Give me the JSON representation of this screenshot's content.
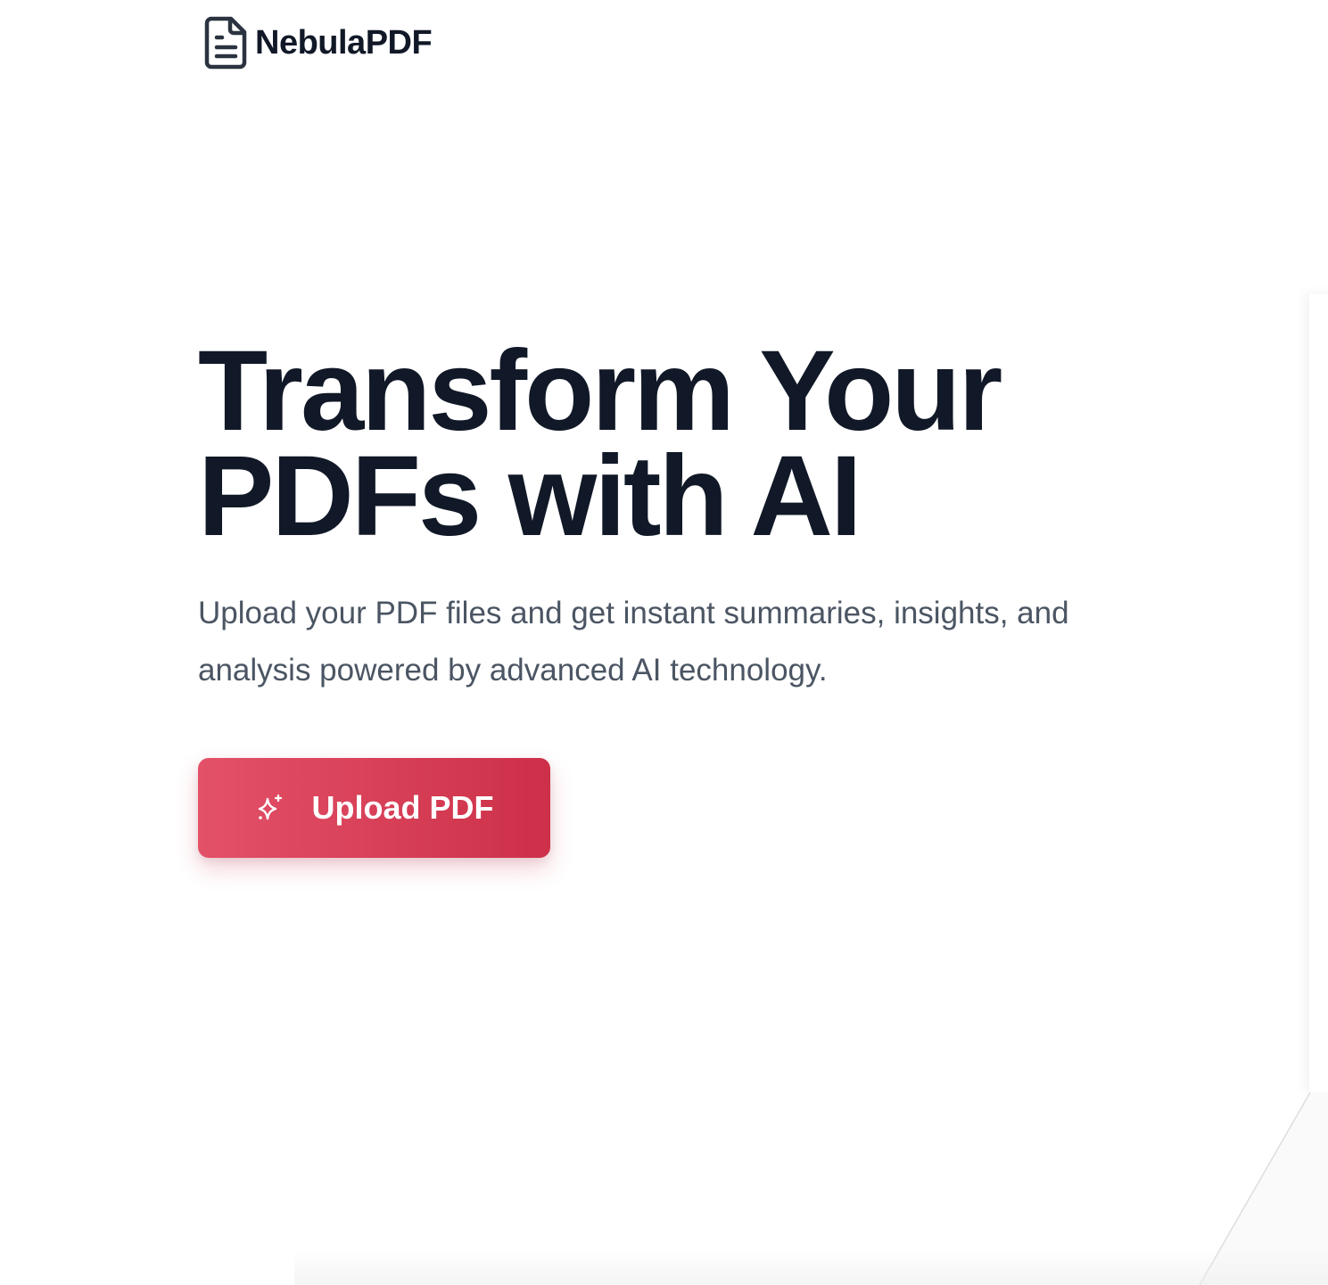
{
  "header": {
    "logo_icon": "document-icon",
    "brand": "NebulaPDF"
  },
  "hero": {
    "title_line1": "Transform Your",
    "title_line2": "PDFs with AI",
    "subtitle": "Upload your PDF files and get instant summaries, insights, and analysis powered by advanced AI technology.",
    "cta": {
      "icon": "sparkle-icon",
      "label": "Upload PDF"
    }
  },
  "colors": {
    "text_primary": "#111827",
    "text_secondary": "#4b5563",
    "accent_start": "#e35168",
    "accent_end": "#cd3049"
  }
}
